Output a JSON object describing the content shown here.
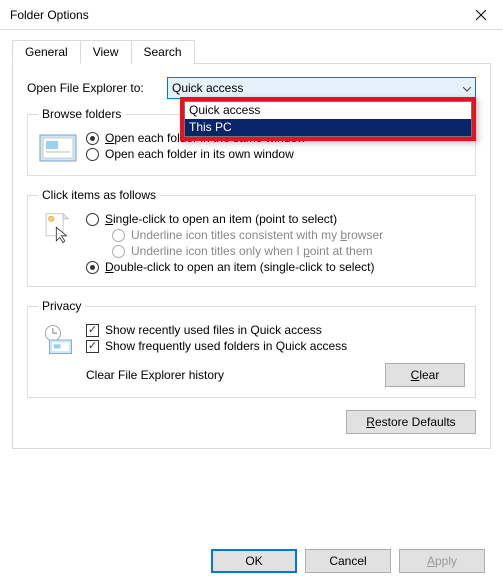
{
  "window": {
    "title": "Folder Options"
  },
  "tabs": {
    "general": "General",
    "view": "View",
    "search": "Search"
  },
  "openExplorer": {
    "label": "Open File Explorer to:",
    "selected": "Quick access",
    "options": [
      "Quick access",
      "This PC"
    ],
    "highlighted": "This PC"
  },
  "browseFolders": {
    "legend": "Browse folders",
    "sameWindow": "pen each folder in the same window",
    "sameWindowKey": "O",
    "ownWindow": "Open each folder in its own window"
  },
  "clickItems": {
    "legend": "Click items as follows",
    "single": "ingle-click to open an item (point to select)",
    "singleKey": "S",
    "underlineBrowser": "Underline icon titles consistent with my ",
    "underlineBrowserKey": "b",
    "underlineBrowserTail": "rowser",
    "underlinePoint": "Underline icon titles only when I ",
    "underlinePointKey": "p",
    "underlinePointTail": "oint at them",
    "double": "ouble-click to open an item (single-click to select)",
    "doubleKey": "D"
  },
  "privacy": {
    "legend": "Privacy",
    "recentFiles": "Show recently used files in Quick access",
    "frequentFolders": "Show frequently used folders in Quick access",
    "clearLabel": "Clear File Explorer history",
    "clearBtn": "lear",
    "clearBtnKey": "C"
  },
  "restoreDefaults": {
    "label": "estore Defaults",
    "key": "R"
  },
  "buttons": {
    "ok": "OK",
    "cancel": "Cancel",
    "apply": "pply",
    "applyKey": "A"
  }
}
